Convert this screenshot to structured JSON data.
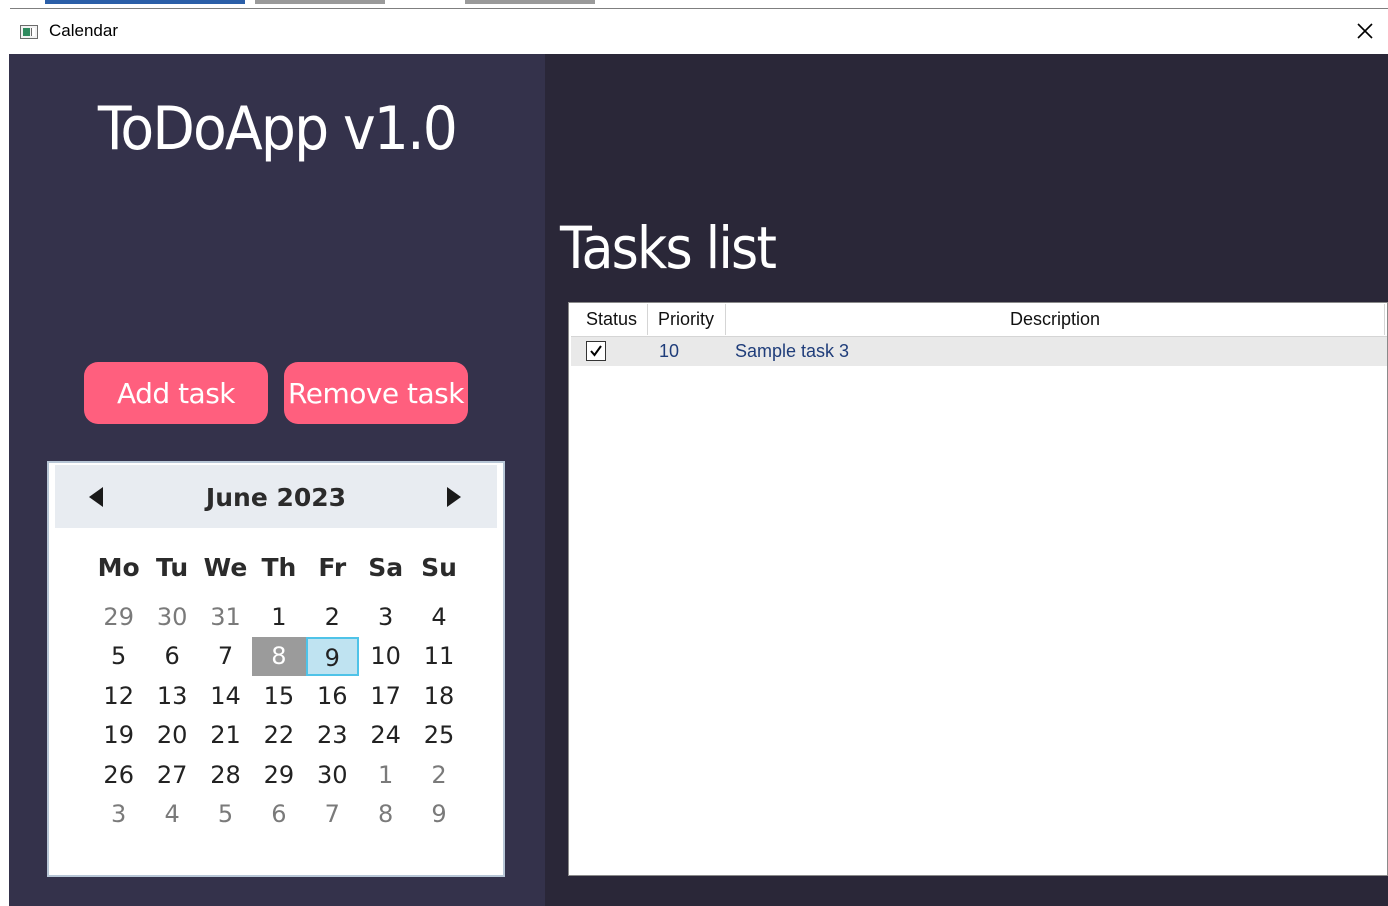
{
  "window": {
    "title": "Calendar"
  },
  "app": {
    "title": "ToDoApp v1.0"
  },
  "buttons": {
    "add_label": "Add task",
    "remove_label": "Remove task"
  },
  "calendar": {
    "month_label": "June 2023",
    "days_of_week": [
      "Mo",
      "Tu",
      "We",
      "Th",
      "Fr",
      "Sa",
      "Su"
    ],
    "selected_day": "8",
    "highlighted_day": "9",
    "weeks": [
      [
        {
          "d": "29",
          "o": true
        },
        {
          "d": "30",
          "o": true
        },
        {
          "d": "31",
          "o": true
        },
        {
          "d": "1"
        },
        {
          "d": "2"
        },
        {
          "d": "3"
        },
        {
          "d": "4"
        }
      ],
      [
        {
          "d": "5"
        },
        {
          "d": "6"
        },
        {
          "d": "7"
        },
        {
          "d": "8",
          "s": "selected"
        },
        {
          "d": "9",
          "s": "today"
        },
        {
          "d": "10"
        },
        {
          "d": "11"
        }
      ],
      [
        {
          "d": "12"
        },
        {
          "d": "13"
        },
        {
          "d": "14"
        },
        {
          "d": "15"
        },
        {
          "d": "16"
        },
        {
          "d": "17"
        },
        {
          "d": "18"
        }
      ],
      [
        {
          "d": "19"
        },
        {
          "d": "20"
        },
        {
          "d": "21"
        },
        {
          "d": "22"
        },
        {
          "d": "23"
        },
        {
          "d": "24"
        },
        {
          "d": "25"
        }
      ],
      [
        {
          "d": "26"
        },
        {
          "d": "27"
        },
        {
          "d": "28"
        },
        {
          "d": "29"
        },
        {
          "d": "30"
        },
        {
          "d": "1",
          "o": true
        },
        {
          "d": "2",
          "o": true
        }
      ],
      [
        {
          "d": "3",
          "o": true
        },
        {
          "d": "4",
          "o": true
        },
        {
          "d": "5",
          "o": true
        },
        {
          "d": "6",
          "o": true
        },
        {
          "d": "7",
          "o": true
        },
        {
          "d": "8",
          "o": true
        },
        {
          "d": "9",
          "o": true
        }
      ]
    ]
  },
  "tasks": {
    "title": "Tasks list",
    "columns": [
      "Status",
      "Priority",
      "Description"
    ],
    "rows": [
      {
        "done": true,
        "priority": "10",
        "description": "Sample task 3"
      }
    ]
  },
  "icons": {
    "app": "app-window-icon",
    "close": "close-icon",
    "prev": "triangle-left-icon",
    "next": "triangle-right-icon",
    "check": "checkmark-icon"
  },
  "colors": {
    "left_panel": "#34324b",
    "right_panel": "#2a2738",
    "accent_button": "#ff5f7e",
    "selected_day": "#9b9b9b",
    "today_fill": "#bfe3f1",
    "today_border": "#4fc3e8",
    "row_text": "#1f3d7a"
  }
}
